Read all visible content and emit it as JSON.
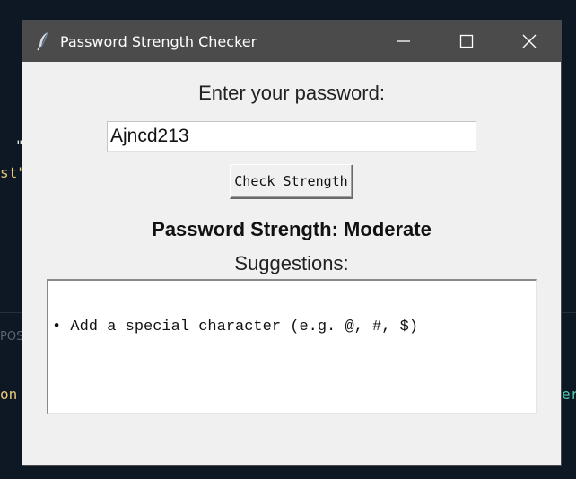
{
  "background": {
    "fragments": [
      {
        "id": "quote",
        "text": "\"",
        "color": "#e6e6e6"
      },
      {
        "id": "st",
        "text": "st\"",
        "color": "#e8c77a"
      },
      {
        "id": "pos",
        "text": "POS",
        "color": "#5b6672"
      },
      {
        "id": "on",
        "text": "on",
        "color": "#e8c77a"
      },
      {
        "id": "er",
        "text": "er",
        "color": "#4ec9b0"
      }
    ]
  },
  "window": {
    "title": "Password Strength Checker",
    "icon": "feather-icon",
    "controls": [
      "minimize-icon",
      "maximize-icon",
      "close-icon"
    ]
  },
  "form": {
    "prompt": "Enter your password:",
    "password_value": "Ajncd213",
    "check_button": "Check Strength",
    "strength_text": "Password Strength: Moderate",
    "suggestions_label": "Suggestions:",
    "suggestions": [
      "• Add a special character (e.g. @, #, $)"
    ]
  }
}
